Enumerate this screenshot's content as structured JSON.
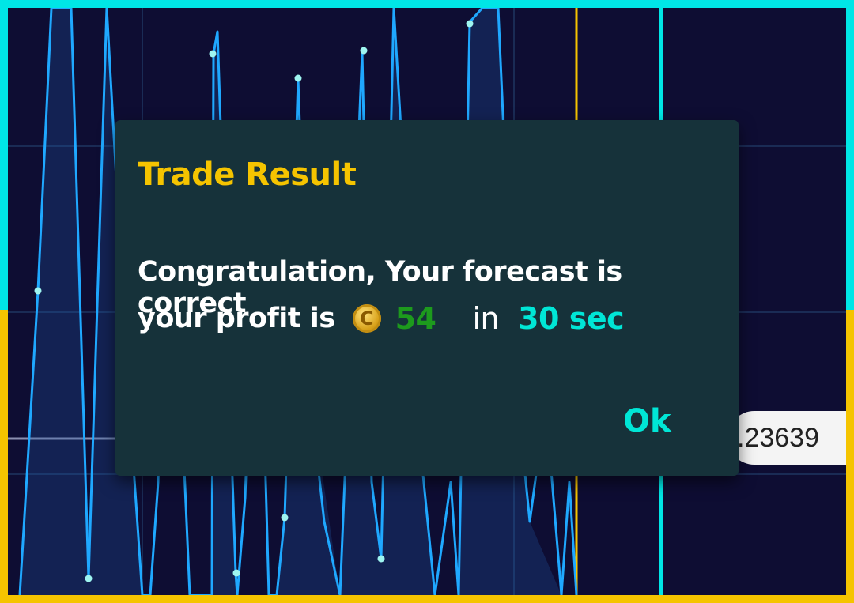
{
  "dialog": {
    "title": "Trade Result",
    "message_line1": "Congratulation, Your forecast is correct",
    "message_line2_prefix": "your profit is",
    "coin_icon": "coin-icon",
    "coin_symbol": "C",
    "profit": "54",
    "in_word": "in",
    "duration": "30 sec",
    "ok_label": "Ok"
  },
  "price_tag": {
    "value": ".23639"
  },
  "colors": {
    "frame_top": "#00e6e6",
    "frame_bottom": "#f5c400",
    "chart_bg": "#0e0d33",
    "line": "#1fa8ff",
    "title": "#f5c400",
    "profit": "#1d9a1d",
    "accent": "#00e6d6",
    "dialog_bg": "#16323a"
  }
}
